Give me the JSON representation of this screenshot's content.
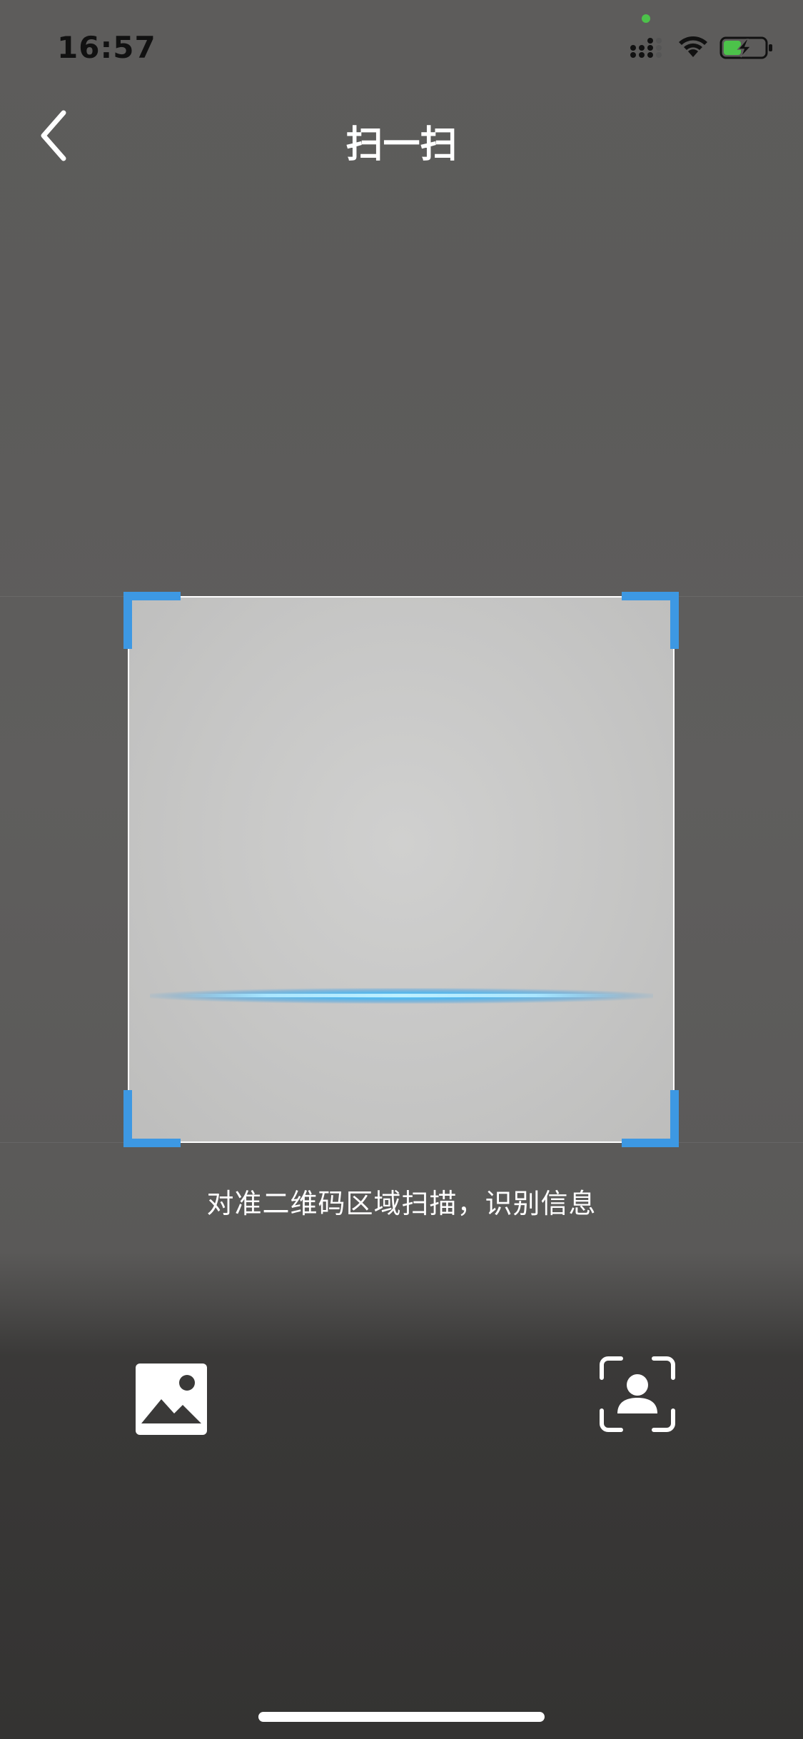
{
  "status_bar": {
    "time": "16:57"
  },
  "nav": {
    "title": "扫一扫",
    "back_icon": "chevron-left-icon"
  },
  "scanner": {
    "hint": "对准二维码区域扫描，识别信息",
    "accent_color": "#3d98e3",
    "scan_line_color": "#5ec2f5"
  },
  "actions": {
    "album_icon": "image-icon",
    "my_qr_icon": "person-scan-icon"
  }
}
